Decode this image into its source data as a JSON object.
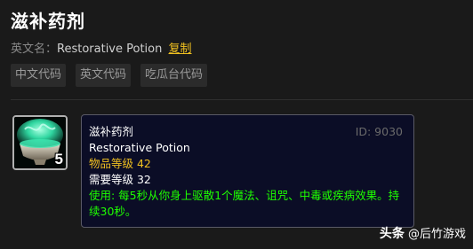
{
  "header": {
    "title": "滋补药剂",
    "english_label": "英文名：",
    "english_name": "Restorative Potion",
    "copy_label": "复制"
  },
  "tabs": [
    {
      "label": "中文代码"
    },
    {
      "label": "英文代码"
    },
    {
      "label": "吃瓜台代码"
    }
  ],
  "item": {
    "icon": "potion-bowl-icon",
    "stack_count": "5",
    "tooltip": {
      "name": "滋补药剂",
      "id_text": "ID: 9030",
      "english_name": "Restorative Potion",
      "item_level": "物品等级 42",
      "required_level": "需要等级 32",
      "use_text": "使用: 每5秒从你身上驱散1个魔法、诅咒、中毒或疾病效果。持续30秒。"
    }
  },
  "watermark": {
    "brand": "头条",
    "author": "@后竹游戏"
  },
  "colors": {
    "background": "#1a1a1a",
    "tooltip_bg": "#0b0d26",
    "accent_gold": "#f0c020",
    "use_green": "#1eff00"
  }
}
